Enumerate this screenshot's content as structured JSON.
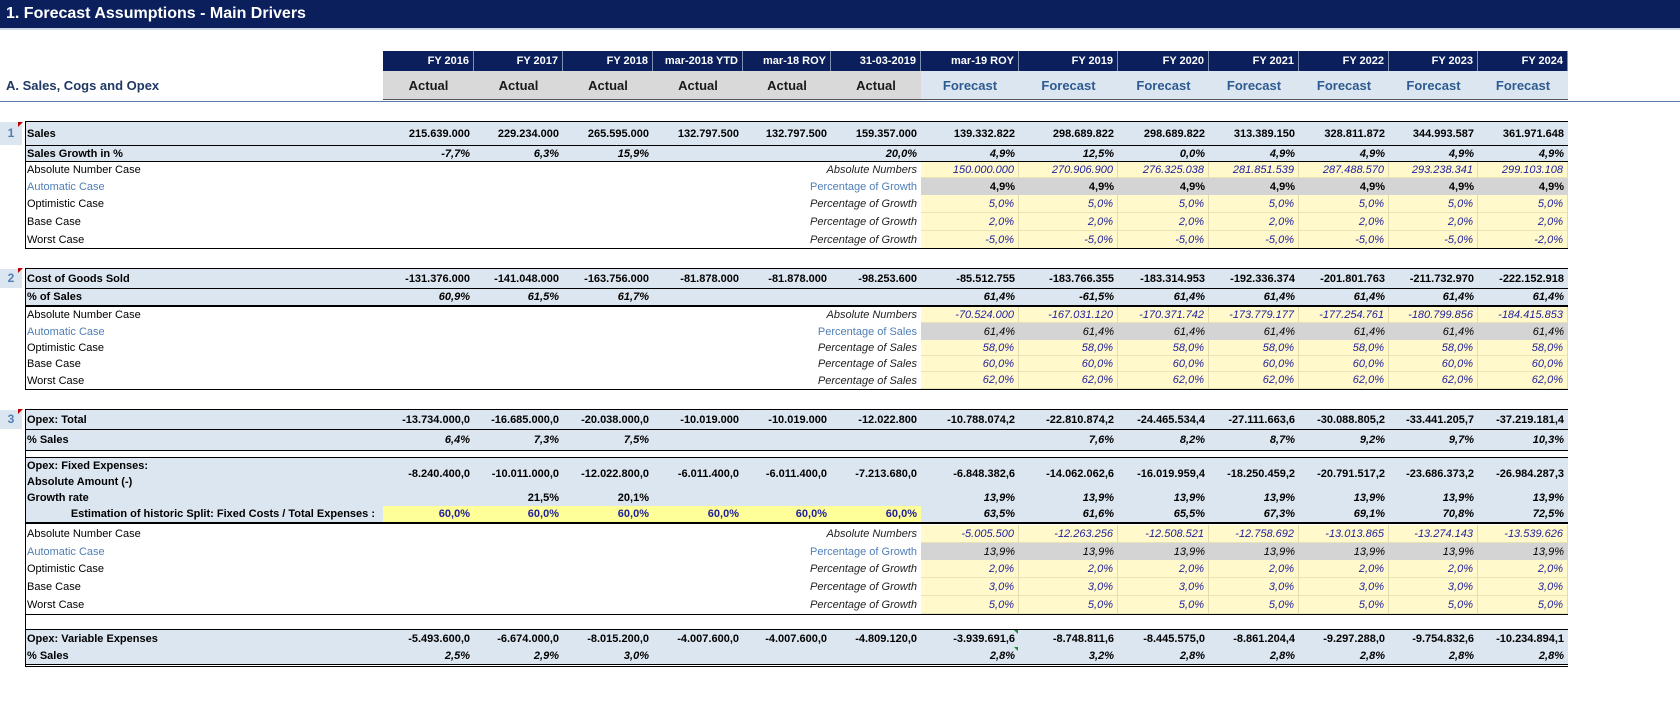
{
  "title": "1. Forecast Assumptions - Main Drivers",
  "section": "A.  Sales, Cogs and Opex",
  "columns": [
    {
      "period": "FY 2016",
      "type": "Actual"
    },
    {
      "period": "FY 2017",
      "type": "Actual"
    },
    {
      "period": "FY 2018",
      "type": "Actual"
    },
    {
      "period": "mar-2018 YTD",
      "type": "Actual"
    },
    {
      "period": "mar-18 ROY",
      "type": "Actual"
    },
    {
      "period": "31-03-2019",
      "type": "Actual"
    },
    {
      "period": "mar-19 ROY",
      "type": "Forecast"
    },
    {
      "period": "FY 2019",
      "type": "Forecast"
    },
    {
      "period": "FY 2020",
      "type": "Forecast"
    },
    {
      "period": "FY 2021",
      "type": "Forecast"
    },
    {
      "period": "FY 2022",
      "type": "Forecast"
    },
    {
      "period": "FY 2023",
      "type": "Forecast"
    },
    {
      "period": "FY 2024",
      "type": "Forecast"
    }
  ],
  "blocks": {
    "sales": {
      "number": "1",
      "main": {
        "label": "Sales",
        "values": [
          "215.639.000",
          "229.234.000",
          "265.595.000",
          "132.797.500",
          "132.797.500",
          "159.357.000",
          "139.332.822",
          "298.689.822",
          "298.689.822",
          "313.389.150",
          "328.811.872",
          "344.993.587",
          "361.971.648"
        ]
      },
      "pct": {
        "label": "Sales Growth in %",
        "values": [
          "-7,7%",
          "6,3%",
          "15,9%",
          "",
          "",
          "20,0%",
          "4,9%",
          "12,5%",
          "0,0%",
          "4,9%",
          "4,9%",
          "4,9%",
          "4,9%"
        ]
      },
      "cases": [
        {
          "label": "Absolute Number Case",
          "method": "Absolute Numbers",
          "values": [
            "150.000.000",
            "270.906.900",
            "276.325.038",
            "281.851.539",
            "287.488.570",
            "293.238.341",
            "299.103.108"
          ]
        },
        {
          "label": "Automatic Case",
          "method": "Percentage of Growth",
          "values": [
            "4,9%",
            "4,9%",
            "4,9%",
            "4,9%",
            "4,9%",
            "4,9%",
            "4,9%"
          ]
        },
        {
          "label": "Optimistic Case",
          "method": "Percentage of Growth",
          "values": [
            "5,0%",
            "5,0%",
            "5,0%",
            "5,0%",
            "5,0%",
            "5,0%",
            "5,0%"
          ]
        },
        {
          "label": "Base Case",
          "method": "Percentage of Growth",
          "values": [
            "2,0%",
            "2,0%",
            "2,0%",
            "2,0%",
            "2,0%",
            "2,0%",
            "2,0%"
          ]
        },
        {
          "label": "Worst Case",
          "method": "Percentage of Growth",
          "values": [
            "-5,0%",
            "-5,0%",
            "-5,0%",
            "-5,0%",
            "-5,0%",
            "-5,0%",
            "-2,0%"
          ]
        }
      ]
    },
    "cogs": {
      "number": "2",
      "main": {
        "label": "Cost of Goods Sold",
        "values": [
          "-131.376.000",
          "-141.048.000",
          "-163.756.000",
          "-81.878.000",
          "-81.878.000",
          "-98.253.600",
          "-85.512.755",
          "-183.766.355",
          "-183.314.953",
          "-192.336.374",
          "-201.801.763",
          "-211.732.970",
          "-222.152.918"
        ]
      },
      "pct": {
        "label": "% of Sales",
        "values": [
          "60,9%",
          "61,5%",
          "61,7%",
          "",
          "",
          "",
          "61,4%",
          "-61,5%",
          "61,4%",
          "61,4%",
          "61,4%",
          "61,4%",
          "61,4%"
        ]
      },
      "cases": [
        {
          "label": "Absolute Number Case",
          "method": "Absolute Numbers",
          "values": [
            "-70.524.000",
            "-167.031.120",
            "-170.371.742",
            "-173.779.177",
            "-177.254.761",
            "-180.799.856",
            "-184.415.853"
          ]
        },
        {
          "label": "Automatic Case",
          "method": "Percentage of Sales",
          "values": [
            "61,4%",
            "61,4%",
            "61,4%",
            "61,4%",
            "61,4%",
            "61,4%",
            "61,4%"
          ]
        },
        {
          "label": "Optimistic Case",
          "method": "Percentage of Sales",
          "values": [
            "58,0%",
            "58,0%",
            "58,0%",
            "58,0%",
            "58,0%",
            "58,0%",
            "58,0%"
          ]
        },
        {
          "label": "Base Case",
          "method": "Percentage of Sales",
          "values": [
            "60,0%",
            "60,0%",
            "60,0%",
            "60,0%",
            "60,0%",
            "60,0%",
            "60,0%"
          ]
        },
        {
          "label": "Worst Case",
          "method": "Percentage of Sales",
          "values": [
            "62,0%",
            "62,0%",
            "62,0%",
            "62,0%",
            "62,0%",
            "62,0%",
            "62,0%"
          ]
        }
      ]
    },
    "opex": {
      "number": "3",
      "main": {
        "label": "Opex: Total",
        "values": [
          "-13.734.000,0",
          "-16.685.000,0",
          "-20.038.000,0",
          "-10.019.000",
          "-10.019.000",
          "-12.022.800",
          "-10.788.074,2",
          "-22.810.874,2",
          "-24.465.534,4",
          "-27.111.663,6",
          "-30.088.805,2",
          "-33.441.205,7",
          "-37.219.181,4"
        ]
      },
      "pct": {
        "label": "% Sales",
        "values": [
          "6,4%",
          "7,3%",
          "7,5%",
          "",
          "",
          "",
          "",
          "7,6%",
          "8,2%",
          "8,7%",
          "9,2%",
          "9,7%",
          "10,3%"
        ]
      },
      "fixed": {
        "label1": "Opex: Fixed Expenses:",
        "label2": "Absolute Amount (-)",
        "values": [
          "-8.240.400,0",
          "-10.011.000,0",
          "-12.022.800,0",
          "-6.011.400,0",
          "-6.011.400,0",
          "-7.213.680,0",
          "-6.848.382,6",
          "-14.062.062,6",
          "-16.019.959,4",
          "-18.250.459,2",
          "-20.791.517,2",
          "-23.686.373,2",
          "-26.984.287,3"
        ],
        "growth_label": "Growth rate",
        "growth": [
          "",
          "21,5%",
          "20,1%",
          "",
          "",
          "",
          "13,9%",
          "13,9%",
          "13,9%",
          "13,9%",
          "13,9%",
          "13,9%",
          "13,9%"
        ],
        "split_label": "Estimation of historic Split: Fixed Costs / Total Expenses :",
        "split": [
          "60,0%",
          "60,0%",
          "60,0%",
          "60,0%",
          "60,0%",
          "60,0%",
          "63,5%",
          "61,6%",
          "65,5%",
          "67,3%",
          "69,1%",
          "70,8%",
          "72,5%"
        ]
      },
      "cases": [
        {
          "label": "Absolute Number Case",
          "method": "Absolute Numbers",
          "values": [
            "-5.005.500",
            "-12.263.256",
            "-12.508.521",
            "-12.758.692",
            "-13.013.865",
            "-13.274.143",
            "-13.539.626"
          ]
        },
        {
          "label": "Automatic Case",
          "method": "Percentage of Growth",
          "values": [
            "13,9%",
            "13,9%",
            "13,9%",
            "13,9%",
            "13,9%",
            "13,9%",
            "13,9%"
          ]
        },
        {
          "label": "Optimistic Case",
          "method": "Percentage of Growth",
          "values": [
            "2,0%",
            "2,0%",
            "2,0%",
            "2,0%",
            "2,0%",
            "2,0%",
            "2,0%"
          ]
        },
        {
          "label": "Base Case",
          "method": "Percentage of Growth",
          "values": [
            "3,0%",
            "3,0%",
            "3,0%",
            "3,0%",
            "3,0%",
            "3,0%",
            "3,0%"
          ]
        },
        {
          "label": "Worst Case",
          "method": "Percentage of Growth",
          "values": [
            "5,0%",
            "5,0%",
            "5,0%",
            "5,0%",
            "5,0%",
            "5,0%",
            "5,0%"
          ]
        }
      ],
      "variable": {
        "label": "Opex: Variable Expenses",
        "values": [
          "-5.493.600,0",
          "-6.674.000,0",
          "-8.015.200,0",
          "-4.007.600,0",
          "-4.007.600,0",
          "-4.809.120,0",
          "-3.939.691,6",
          "-8.748.811,6",
          "-8.445.575,0",
          "-8.861.204,4",
          "-9.297.288,0",
          "-9.754.832,6",
          "-10.234.894,1"
        ],
        "pct_label": "% Sales",
        "pct": [
          "2,5%",
          "2,9%",
          "3,0%",
          "",
          "",
          "",
          "2,8%",
          "3,2%",
          "2,8%",
          "2,8%",
          "2,8%",
          "2,8%",
          "2,8%"
        ]
      }
    }
  }
}
